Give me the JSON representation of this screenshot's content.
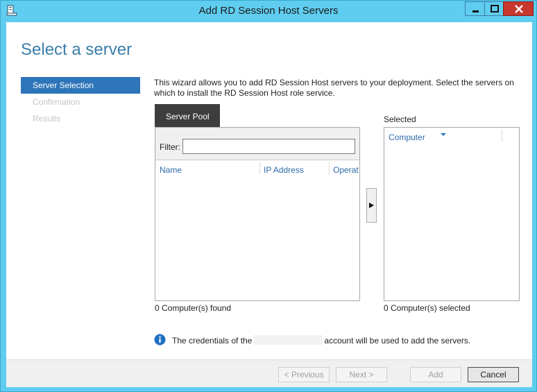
{
  "window": {
    "title": "Add RD Session Host Servers",
    "accent_color": "#5fcdef",
    "icons": [
      "server-app-icon",
      "minimize-icon",
      "maximize-icon",
      "close-icon"
    ]
  },
  "page": {
    "heading": "Select a server"
  },
  "nav": {
    "items": [
      {
        "label": "Server Selection",
        "state": "active"
      },
      {
        "label": "Confirmation",
        "state": "disabled"
      },
      {
        "label": "Results",
        "state": "disabled"
      }
    ]
  },
  "intro": {
    "line1": "This wizard allows you to add RD Session Host servers to your deployment. Select the servers on",
    "line2": "which to install the RD Session Host role service."
  },
  "server_pool": {
    "tab_label": "Server Pool",
    "filter_label": "Filter:",
    "filter_value": "",
    "columns": [
      "Name",
      "IP Address",
      "Operat"
    ],
    "rows": [],
    "count_text": "0 Computer(s) found"
  },
  "selected": {
    "label": "Selected",
    "columns": [
      "Computer"
    ],
    "rows": [],
    "count_text": "0 Computer(s) selected"
  },
  "info": {
    "text_before": "The credentials of the",
    "text_after": "account will be used to add the servers."
  },
  "buttons": {
    "previous": "< Previous",
    "next": "Next >",
    "add": "Add",
    "cancel": "Cancel"
  }
}
